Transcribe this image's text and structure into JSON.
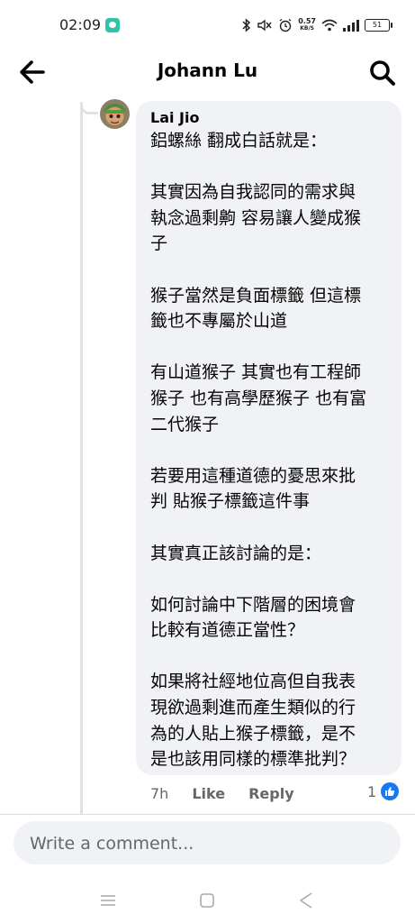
{
  "status_bar": {
    "time": "02:09",
    "net_speed_value": "0.57",
    "net_speed_unit": "KB/S",
    "battery": "51"
  },
  "header": {
    "title": "Johann Lu"
  },
  "comment": {
    "author": "Lai Jio",
    "paragraphs": [
      "鋁螺絲 翻成白話就是：",
      "其實因為自我認同的需求與\n執念過剩齁 容易讓人變成猴\n子",
      "猴子當然是負面標籤  但這標\n籤也不專屬於山道",
      "有山道猴子 其實也有工程師\n猴子 也有高學歷猴子 也有富\n二代猴子",
      "若要用這種道德的憂思來批\n判 貼猴子標籤這件事",
      "其實真正該討論的是：",
      "如何討論中下階層的困境會\n比較有道德正當性？",
      "如果將社經地位高但自我表\n現欲過剩進而產生類似的行\n為的人貼上猴子標籤，是不\n是也該用同樣的標準批判？"
    ],
    "time": "7h",
    "like_label": "Like",
    "reply_label": "Reply",
    "reaction_count": "1"
  },
  "composer": {
    "placeholder": "Write a comment..."
  },
  "colors": {
    "accent": "#1877f2",
    "bubble": "#f0f2f5",
    "secondary_text": "#65676b"
  },
  "icons": {
    "back": "arrow-left-icon",
    "search": "search-icon",
    "like": "thumbs-up-icon",
    "nav_menu": "menu-icon",
    "nav_home": "square-icon",
    "nav_back": "triangle-back-icon"
  }
}
